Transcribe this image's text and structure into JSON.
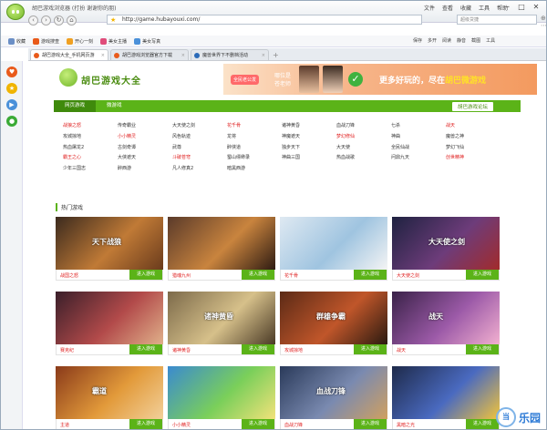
{
  "window": {
    "title": "胡巴游戏浏览器 (打扮 谢谢你的朋)",
    "menu": [
      "文件",
      "查看",
      "收藏",
      "工具",
      "帮助"
    ],
    "btn_min": "─",
    "btn_max": "□",
    "btn_close": "✕"
  },
  "nav": {
    "back": "‹",
    "forward": "›",
    "refresh": "↻",
    "home": "⌂",
    "address": "http://game.hubayouxi.com/",
    "search_placeholder": "超级贷捷",
    "tools": "⊕ ⋯"
  },
  "favbar": {
    "items": [
      {
        "label": "收藏",
        "color": "#6b8fc6"
      },
      {
        "label": "游戏搜查",
        "color": "#e95a1a"
      },
      {
        "label": "开心一刻",
        "color": "#f0a022"
      },
      {
        "label": "美女主播",
        "color": "#e04c7a"
      },
      {
        "label": "美女写真",
        "color": "#4a90d9"
      }
    ],
    "right": [
      "保存",
      "多开",
      "阅读",
      "静音",
      "截图",
      "工具"
    ]
  },
  "tabs": [
    {
      "label": "胡巴游戏大全_手机网页游",
      "active": true
    },
    {
      "label": "胡巴游戏浏览器官方下载",
      "active": false
    },
    {
      "label": "魔兽世界下不删档活动",
      "active": false
    }
  ],
  "tab_plus": "+",
  "sidebar": [
    {
      "color": "#e95a1a",
      "glyph": "♥"
    },
    {
      "color": "#f0b400",
      "glyph": "★"
    },
    {
      "color": "#4a90d9",
      "glyph": "▶"
    },
    {
      "color": "#3aaa35",
      "glyph": "●"
    }
  ],
  "site": {
    "title": "胡巴游戏大全",
    "banner_tag": "全民老公发",
    "banner_teacher_1": "哪位是",
    "banner_teacher_2": "苍老师",
    "banner_tick": "✓",
    "banner_more_1": "更多好玩的，尽在",
    "banner_more_2": "胡巴微游戏"
  },
  "green_nav": {
    "items": [
      "网页游戏",
      "微游戏"
    ],
    "right": "胡巴游戏论坛"
  },
  "game_grid": [
    [
      {
        "t": "战狼之怒",
        "c": "red"
      },
      {
        "t": "传奇霸业",
        "c": ""
      },
      {
        "t": "大天使之剑",
        "c": ""
      },
      {
        "t": "花千骨",
        "c": "red"
      },
      {
        "t": "诸神黄昏",
        "c": ""
      },
      {
        "t": "血战刀锋",
        "c": ""
      },
      {
        "t": "七杀",
        "c": ""
      },
      {
        "t": "战天",
        "c": "red"
      }
    ],
    [
      {
        "t": "攻城掠地",
        "c": ""
      },
      {
        "t": "小小精灵",
        "c": "red"
      },
      {
        "t": "风色轨迹",
        "c": ""
      },
      {
        "t": "龙将",
        "c": ""
      },
      {
        "t": "神魔遮天",
        "c": ""
      },
      {
        "t": "梦幻修仙",
        "c": "red"
      },
      {
        "t": "神曲",
        "c": ""
      },
      {
        "t": "魔兽之神",
        "c": ""
      }
    ],
    [
      {
        "t": "热血屠龙2",
        "c": ""
      },
      {
        "t": "古剑奇谭",
        "c": ""
      },
      {
        "t": "武尊",
        "c": ""
      },
      {
        "t": "醉侠道",
        "c": ""
      },
      {
        "t": "独步天下",
        "c": ""
      },
      {
        "t": "大天使",
        "c": ""
      },
      {
        "t": "全民仙战",
        "c": ""
      },
      {
        "t": "梦幻飞仙",
        "c": ""
      }
    ],
    [
      {
        "t": "霸王之心",
        "c": "red"
      },
      {
        "t": "大侠遮天",
        "c": ""
      },
      {
        "t": "斗破苍穹",
        "c": "red"
      },
      {
        "t": "蜀山缥缈录",
        "c": ""
      },
      {
        "t": "神曲三国",
        "c": ""
      },
      {
        "t": "热血战歌",
        "c": ""
      },
      {
        "t": "问鼎九天",
        "c": ""
      },
      {
        "t": "创世精神",
        "c": "red"
      }
    ],
    [
      {
        "t": "少年三国志",
        "c": ""
      },
      {
        "t": "醉西游",
        "c": ""
      },
      {
        "t": "凡人修真2",
        "c": ""
      },
      {
        "t": "暗黑西游",
        "c": ""
      },
      {
        "t": "",
        "c": ""
      },
      {
        "t": "",
        "c": ""
      },
      {
        "t": "",
        "c": ""
      },
      {
        "t": "",
        "c": ""
      }
    ]
  ],
  "hot_title": "热门游戏",
  "play_label": "进入游戏",
  "cards": [
    {
      "name": "战国之怒",
      "overlay": "天下战狼",
      "colors": [
        "#3b2a1e",
        "#c07a36",
        "#6a3b1c"
      ]
    },
    {
      "name": "猎魂九州",
      "overlay": "",
      "colors": [
        "#5a3a2a",
        "#c9843e",
        "#2e1b12"
      ]
    },
    {
      "name": "花千骨",
      "overlay": "",
      "colors": [
        "#dfe9f2",
        "#9fc4e0",
        "#f4f4f4"
      ]
    },
    {
      "name": "大天使之剑",
      "overlay": "大天使之剑",
      "colors": [
        "#1e2240",
        "#6d3c7a",
        "#a22b2b"
      ]
    },
    {
      "name": "赛克纪",
      "overlay": "",
      "colors": [
        "#3a1f2a",
        "#b24a4a",
        "#e0b08a"
      ]
    },
    {
      "name": "诸神黄昏",
      "overlay": "诸神黄昏",
      "colors": [
        "#7c6a4a",
        "#d6c08a",
        "#4a3a26"
      ]
    },
    {
      "name": "攻城掠地",
      "overlay": "群雄争霸",
      "colors": [
        "#5b2a16",
        "#c0562a",
        "#2a1a10"
      ]
    },
    {
      "name": "战天",
      "overlay": "战天",
      "colors": [
        "#3a2248",
        "#9c5aa8",
        "#f2b0d0"
      ]
    },
    {
      "name": "主道",
      "overlay": "霸道",
      "colors": [
        "#8a3a1a",
        "#e29a3a",
        "#f2d09a"
      ]
    },
    {
      "name": "小小精灵",
      "overlay": "",
      "colors": [
        "#3a8ad0",
        "#7acf5a",
        "#f2e27a"
      ]
    },
    {
      "name": "血战刀锋",
      "overlay": "血战刀锋",
      "colors": [
        "#2a3a5a",
        "#7a8ab0",
        "#d0a060"
      ]
    },
    {
      "name": "黑暗之光",
      "overlay": "",
      "colors": [
        "#1e2a4a",
        "#4a6ac0",
        "#f2c43a"
      ]
    }
  ],
  "watermark": {
    "badge": "当",
    "text": "乐园"
  }
}
